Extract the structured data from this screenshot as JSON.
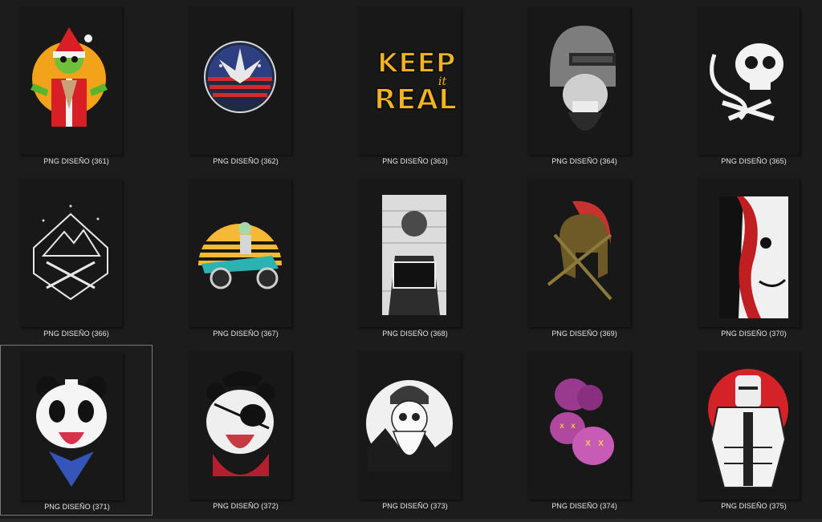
{
  "files": [
    {
      "name": "PNG DISEÑO (361)",
      "icon": "zombie-santa-icon"
    },
    {
      "name": "PNG DISEÑO (362)",
      "icon": "usa-leaf-emblem-icon"
    },
    {
      "name": "PNG DISEÑO (363)",
      "icon": "keep-it-real-lettering-icon"
    },
    {
      "name": "PNG DISEÑO (364)",
      "icon": "helmet-skull-icon"
    },
    {
      "name": "PNG DISEÑO (365)",
      "icon": "skull-snake-icon"
    },
    {
      "name": "PNG DISEÑO (366)",
      "icon": "mountain-badge-icon"
    },
    {
      "name": "PNG DISEÑO (367)",
      "icon": "sunset-rider-icon"
    },
    {
      "name": "PNG DISEÑO (368)",
      "icon": "mugshot-zombie-icon"
    },
    {
      "name": "PNG DISEÑO (369)",
      "icon": "spartan-helmet-icon"
    },
    {
      "name": "PNG DISEÑO (370)",
      "icon": "bloody-face-icon"
    },
    {
      "name": "PNG DISEÑO (371)",
      "icon": "sailor-panda-icon"
    },
    {
      "name": "PNG DISEÑO (372)",
      "icon": "pirate-panda-icon"
    },
    {
      "name": "PNG DISEÑO (373)",
      "icon": "bearded-skull-icon"
    },
    {
      "name": "PNG DISEÑO (374)",
      "icon": "pink-skulls-icon"
    },
    {
      "name": "PNG DISEÑO (375)",
      "icon": "knight-armor-icon"
    }
  ],
  "artwork_text": {
    "keep": "KEEP",
    "it": "it",
    "real": "REAL"
  },
  "colors": {
    "background": "#1c1c1c",
    "thumb_background": "#181818",
    "caption": "#e6e6e6",
    "selection_border": "#7a7a7a"
  }
}
